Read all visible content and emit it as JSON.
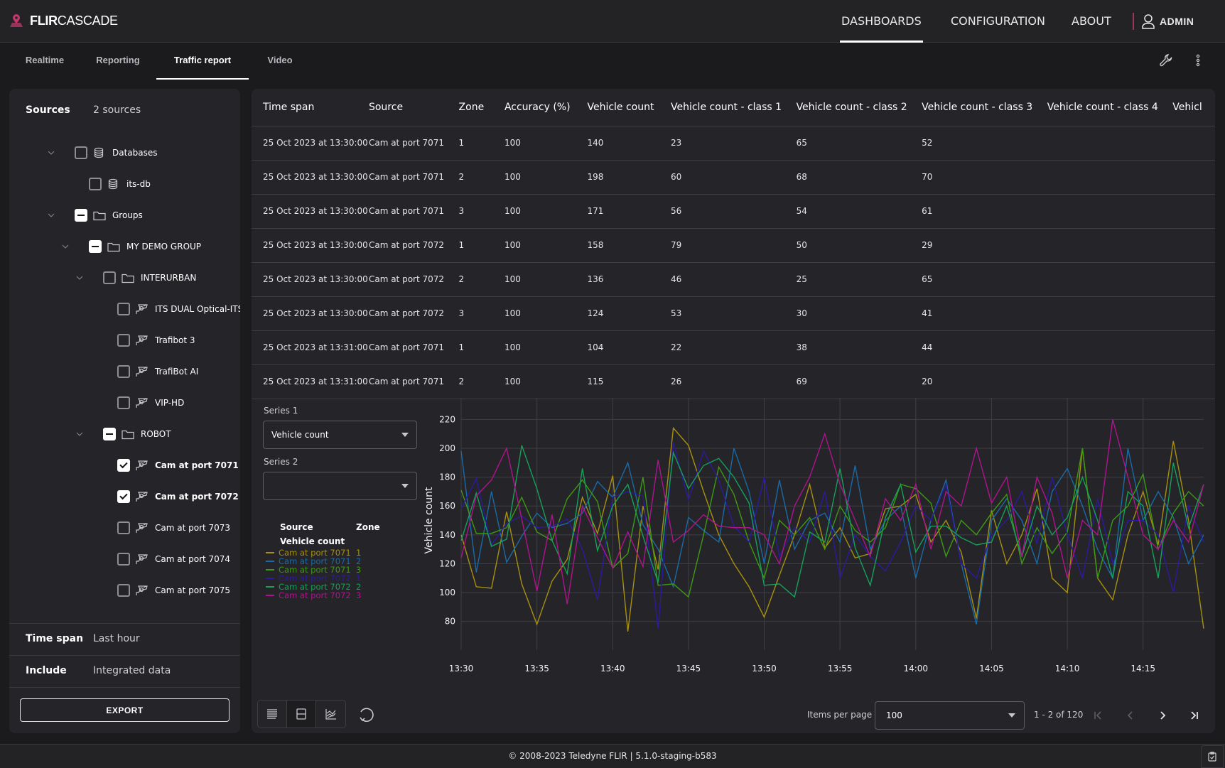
{
  "app": {
    "brand_bold": "FLIR",
    "brand_light": "CASCADE",
    "accent": "#c2386b"
  },
  "topnav": {
    "items": [
      {
        "label": "DASHBOARDS",
        "active": true
      },
      {
        "label": "CONFIGURATION",
        "active": false
      },
      {
        "label": "ABOUT",
        "active": false
      }
    ],
    "user": "ADMIN"
  },
  "subtabs": [
    {
      "label": "Realtime",
      "active": false
    },
    {
      "label": "Reporting",
      "active": false
    },
    {
      "label": "Traffic report",
      "active": true
    },
    {
      "label": "Video",
      "active": false
    }
  ],
  "sidebar": {
    "sources_label": "Sources",
    "sources_value": "2 sources",
    "tree": [
      {
        "label": "Databases",
        "icon": "database-icon",
        "state": "unchecked",
        "expandable": true,
        "bold": false
      },
      {
        "label": "its-db",
        "icon": "database-icon",
        "state": "unchecked",
        "expandable": false,
        "bold": false
      },
      {
        "label": "Groups",
        "icon": "folder-icon",
        "state": "indeterminate",
        "expandable": true,
        "bold": false
      },
      {
        "label": "MY DEMO GROUP",
        "icon": "folder-icon",
        "state": "indeterminate",
        "expandable": true,
        "bold": false
      },
      {
        "label": "INTERURBAN",
        "icon": "folder-icon",
        "state": "unchecked",
        "expandable": true,
        "bold": false
      },
      {
        "label": "ITS DUAL Optical-ITS",
        "icon": "camera-icon",
        "state": "unchecked",
        "expandable": false,
        "bold": false
      },
      {
        "label": "Trafibot 3",
        "icon": "camera-icon",
        "state": "unchecked",
        "expandable": false,
        "bold": false
      },
      {
        "label": "TrafiBot AI",
        "icon": "camera-icon",
        "state": "unchecked",
        "expandable": false,
        "bold": false
      },
      {
        "label": "VIP-HD",
        "icon": "camera-icon",
        "state": "unchecked",
        "expandable": false,
        "bold": false
      },
      {
        "label": "ROBOT",
        "icon": "folder-icon",
        "state": "indeterminate",
        "expandable": true,
        "bold": false
      },
      {
        "label": "Cam at port 7071",
        "icon": "camera-icon",
        "state": "checked",
        "expandable": false,
        "bold": true
      },
      {
        "label": "Cam at port 7072",
        "icon": "camera-icon",
        "state": "checked",
        "expandable": false,
        "bold": true
      },
      {
        "label": "Cam at port 7073",
        "icon": "camera-icon",
        "state": "unchecked",
        "expandable": false,
        "bold": false
      },
      {
        "label": "Cam at port 7074",
        "icon": "camera-icon",
        "state": "unchecked",
        "expandable": false,
        "bold": false
      },
      {
        "label": "Cam at port 7075",
        "icon": "camera-icon",
        "state": "unchecked",
        "expandable": false,
        "bold": false
      }
    ],
    "timespan_label": "Time span",
    "timespan_value": "Last hour",
    "include_label": "Include",
    "include_value": "Integrated data",
    "export_label": "EXPORT"
  },
  "table": {
    "columns": [
      "Time span",
      "Source",
      "Zone",
      "Accuracy (%)",
      "Vehicle count",
      "Vehicle count - class 1",
      "Vehicle count - class 2",
      "Vehicle count - class 3",
      "Vehicle count - class 4",
      "Vehicl"
    ],
    "rows": [
      [
        "25 Oct 2023 at 13:30:00",
        "Cam at port 7071",
        "1",
        "100",
        "140",
        "23",
        "65",
        "52",
        "",
        ""
      ],
      [
        "25 Oct 2023 at 13:30:00",
        "Cam at port 7071",
        "2",
        "100",
        "198",
        "60",
        "68",
        "70",
        "",
        ""
      ],
      [
        "25 Oct 2023 at 13:30:00",
        "Cam at port 7071",
        "3",
        "100",
        "171",
        "56",
        "54",
        "61",
        "",
        ""
      ],
      [
        "25 Oct 2023 at 13:30:00",
        "Cam at port 7072",
        "1",
        "100",
        "158",
        "79",
        "50",
        "29",
        "",
        ""
      ],
      [
        "25 Oct 2023 at 13:30:00",
        "Cam at port 7072",
        "2",
        "100",
        "136",
        "46",
        "25",
        "65",
        "",
        ""
      ],
      [
        "25 Oct 2023 at 13:30:00",
        "Cam at port 7072",
        "3",
        "100",
        "124",
        "53",
        "30",
        "41",
        "",
        ""
      ],
      [
        "25 Oct 2023 at 13:31:00",
        "Cam at port 7071",
        "1",
        "100",
        "104",
        "22",
        "38",
        "44",
        "",
        ""
      ],
      [
        "25 Oct 2023 at 13:31:00",
        "Cam at port 7071",
        "2",
        "100",
        "115",
        "26",
        "69",
        "20",
        "",
        ""
      ]
    ]
  },
  "series_controls": {
    "series1_label": "Series 1",
    "series1_value": "Vehicle count",
    "series2_label": "Series 2",
    "series2_value": ""
  },
  "legend": {
    "source_header": "Source",
    "zone_header": "Zone",
    "metric_header": "Vehicle count"
  },
  "pagination": {
    "items_per_page_label": "Items per page",
    "items_per_page_value": "100",
    "range": "1 - 2 of 120"
  },
  "footer": {
    "text": "© 2008-2023 Teledyne FLIR | 5.1.0-staging-b583"
  },
  "chart_data": {
    "type": "line",
    "title": "",
    "xlabel": "",
    "ylabel": "Vehicle count",
    "ylim": [
      70,
      230
    ],
    "yticks": [
      80,
      100,
      120,
      140,
      160,
      180,
      200,
      220
    ],
    "xticks": [
      "13:30",
      "13:35",
      "13:40",
      "13:45",
      "13:50",
      "13:55",
      "14:00",
      "14:05",
      "14:10",
      "14:15"
    ],
    "x_start_minute": 0,
    "x_end_minute": 49,
    "grid": true,
    "legend_position": "left",
    "series": [
      {
        "name": "Cam at port 7071",
        "zone": "1",
        "color": "#a8900f",
        "values": [
          140,
          104,
          103,
          156,
          106,
          78,
          108,
          123,
          166,
          141,
          181,
          73,
          160,
          116,
          214,
          202,
          170,
          140,
          120,
          104,
          83,
          112,
          140,
          175,
          131,
          145,
          124,
          127,
          158,
          160,
          168,
          135,
          150,
          128,
          82,
          157,
          120,
          140,
          172,
          110,
          100,
          200,
          110,
          95,
          140,
          170,
          133,
          205,
          150,
          75
        ]
      },
      {
        "name": "Cam at port 7071",
        "zone": "2",
        "color": "#1a6aa8",
        "values": [
          198,
          114,
          170,
          121,
          139,
          155,
          145,
          148,
          155,
          177,
          166,
          190,
          147,
          130,
          104,
          152,
          143,
          135,
          200,
          170,
          120,
          178,
          130,
          150,
          155,
          135,
          188,
          130,
          150,
          160,
          110,
          150,
          178,
          120,
          78,
          150,
          165,
          150,
          120,
          170,
          186,
          160,
          130,
          110,
          200,
          150,
          170,
          152,
          120,
          140
        ]
      },
      {
        "name": "Cam at port 7071",
        "zone": "3",
        "color": "#3d9a12",
        "values": [
          171,
          141,
          141,
          145,
          166,
          142,
          136,
          165,
          178,
          163,
          117,
          127,
          180,
          105,
          106,
          97,
          140,
          187,
          168,
          135,
          110,
          150,
          140,
          152,
          130,
          160,
          143,
          135,
          145,
          175,
          172,
          162,
          125,
          150,
          140,
          155,
          168,
          120,
          145,
          127,
          142,
          200,
          110,
          150,
          160,
          182,
          130,
          155,
          170,
          160
        ]
      },
      {
        "name": "Cam at port 7072",
        "zone": "1",
        "color": "#2b1aa0",
        "values": [
          158,
          179,
          133,
          148,
          153,
          145,
          146,
          151,
          130,
          95,
          166,
          170,
          167,
          75,
          204,
          164,
          198,
          178,
          146,
          135,
          180,
          125,
          145,
          135,
          170,
          110,
          140,
          125,
          115,
          135,
          160,
          150,
          175,
          120,
          110,
          140,
          150,
          170,
          134,
          180,
          140,
          110,
          165,
          120,
          150,
          150,
          140,
          100,
          160,
          135
        ]
      },
      {
        "name": "Cam at port 7072",
        "zone": "2",
        "color": "#16a05a",
        "values": [
          136,
          169,
          132,
          137,
          202,
          172,
          136,
          113,
          186,
          129,
          160,
          175,
          139,
          107,
          197,
          172,
          188,
          193,
          180,
          162,
          105,
          106,
          97,
          142,
          135,
          186,
          131,
          105,
          152,
          175,
          128,
          146,
          146,
          138,
          133,
          135,
          160,
          125,
          160,
          140,
          152,
          180,
          150,
          110,
          170,
          160,
          110,
          190,
          145,
          175
        ]
      },
      {
        "name": "Cam at port 7072",
        "zone": "3",
        "color": "#b0138d",
        "values": [
          124,
          167,
          178,
          200,
          151,
          101,
          154,
          92,
          160,
          138,
          117,
          142,
          118,
          192,
          135,
          143,
          154,
          146,
          145,
          145,
          140,
          120,
          160,
          180,
          210,
          175,
          150,
          125,
          165,
          150,
          175,
          130,
          170,
          160,
          200,
          162,
          180,
          125,
          180,
          155,
          110,
          150,
          140,
          220,
          180,
          140,
          130,
          150,
          135,
          175
        ]
      }
    ]
  }
}
